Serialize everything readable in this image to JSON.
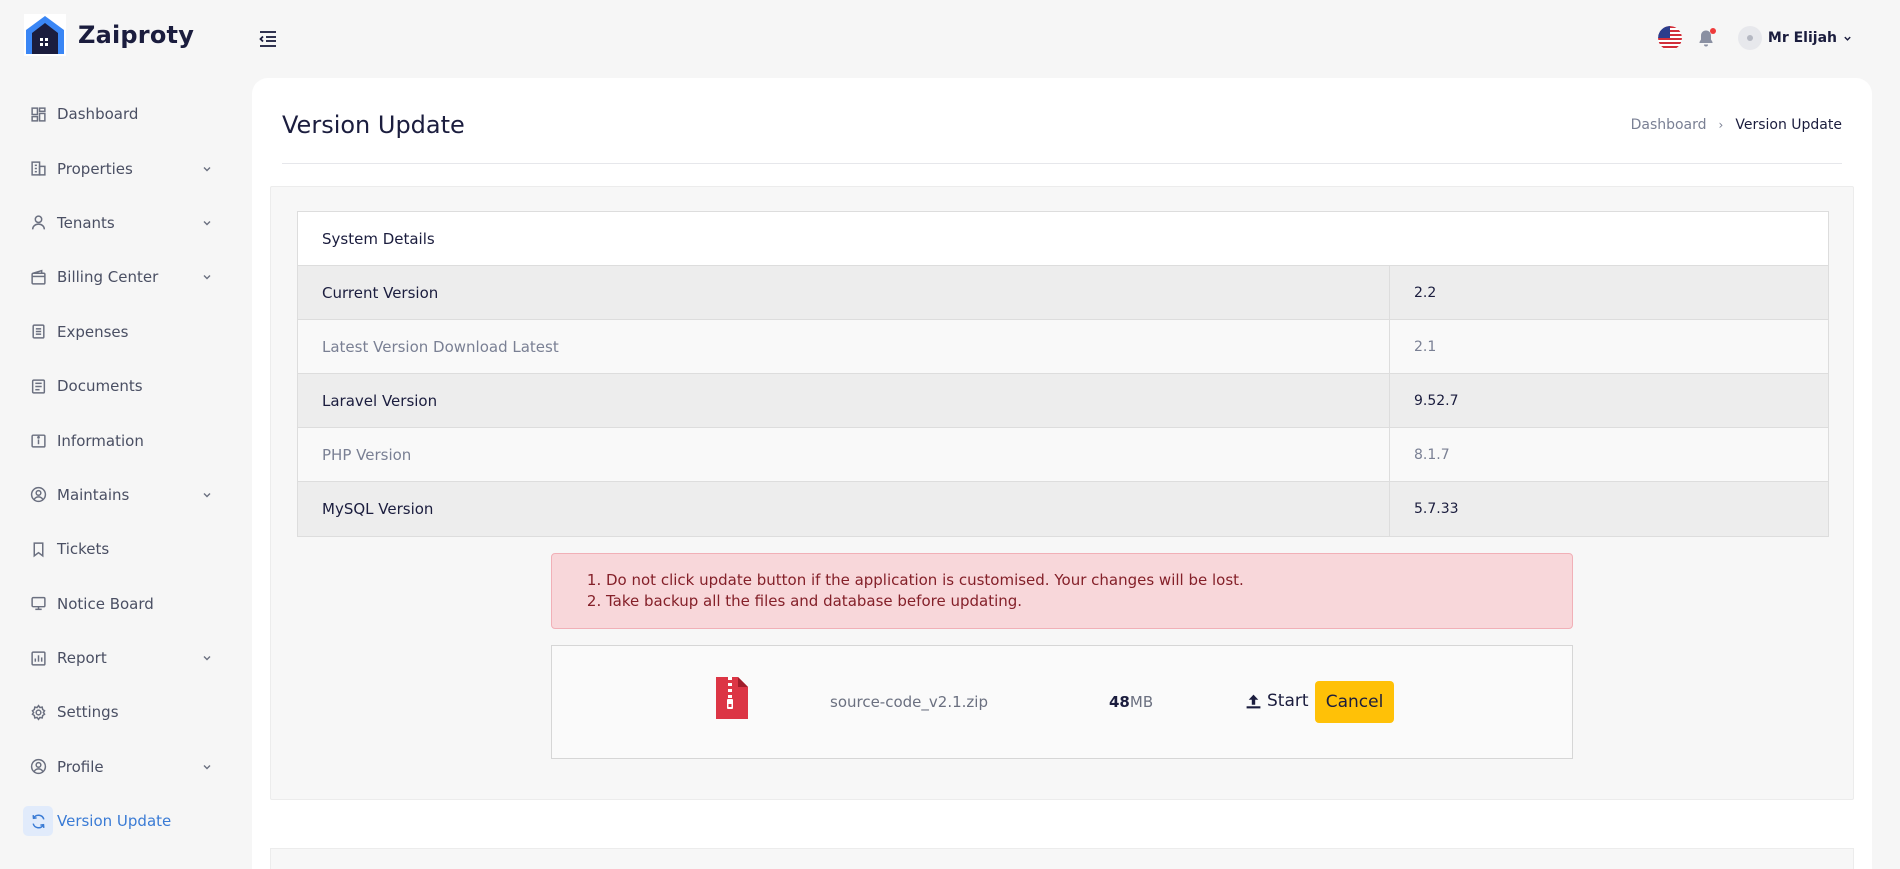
{
  "brand": {
    "name": "Zaiproty"
  },
  "sidebar": {
    "items": [
      {
        "label": "Dashboard",
        "icon": "dashboard-icon",
        "has_submenu": false
      },
      {
        "label": "Properties",
        "icon": "building-icon",
        "has_submenu": true
      },
      {
        "label": "Tenants",
        "icon": "user-icon",
        "has_submenu": true
      },
      {
        "label": "Billing Center",
        "icon": "wallet-icon",
        "has_submenu": true
      },
      {
        "label": "Expenses",
        "icon": "receipt-icon",
        "has_submenu": false
      },
      {
        "label": "Documents",
        "icon": "document-icon",
        "has_submenu": false
      },
      {
        "label": "Information",
        "icon": "info-icon",
        "has_submenu": false
      },
      {
        "label": "Maintains",
        "icon": "user-circle-icon",
        "has_submenu": true
      },
      {
        "label": "Tickets",
        "icon": "bookmark-icon",
        "has_submenu": false
      },
      {
        "label": "Notice Board",
        "icon": "monitor-icon",
        "has_submenu": false
      },
      {
        "label": "Report",
        "icon": "chart-icon",
        "has_submenu": true
      },
      {
        "label": "Settings",
        "icon": "gear-icon",
        "has_submenu": false
      },
      {
        "label": "Profile",
        "icon": "profile-icon",
        "has_submenu": true
      },
      {
        "label": "Version Update",
        "icon": "refresh-icon",
        "has_submenu": false,
        "active": true
      }
    ]
  },
  "topbar": {
    "user_name": "Mr Elijah",
    "language_flag": "us-flag-icon",
    "has_notification": true
  },
  "page": {
    "title": "Version Update",
    "breadcrumb": [
      "Dashboard",
      "Version Update"
    ]
  },
  "system_details": {
    "heading": "System Details",
    "rows": [
      {
        "label": "Current Version",
        "value": "2.2"
      },
      {
        "label": "Latest Version Download Latest",
        "value": "2.1"
      },
      {
        "label": "Laravel Version",
        "value": "9.52.7"
      },
      {
        "label": "PHP Version",
        "value": "8.1.7"
      },
      {
        "label": "MySQL Version",
        "value": "5.7.33"
      }
    ]
  },
  "warning": {
    "items": [
      "Do not click update button if the application is customised. Your changes will be lost.",
      "Take backup all the files and database before updating."
    ]
  },
  "upload": {
    "file_name": "source-code_v2.1.zip",
    "size_value": "48",
    "size_unit": "MB",
    "start_label": "Start",
    "cancel_label": "Cancel"
  },
  "colors": {
    "accent": "#3a7bd5",
    "brand_dark": "#1b1d3e",
    "warning_bg": "#f8d7da",
    "cancel_button": "#ffc107",
    "zip_icon": "#dc3545"
  }
}
